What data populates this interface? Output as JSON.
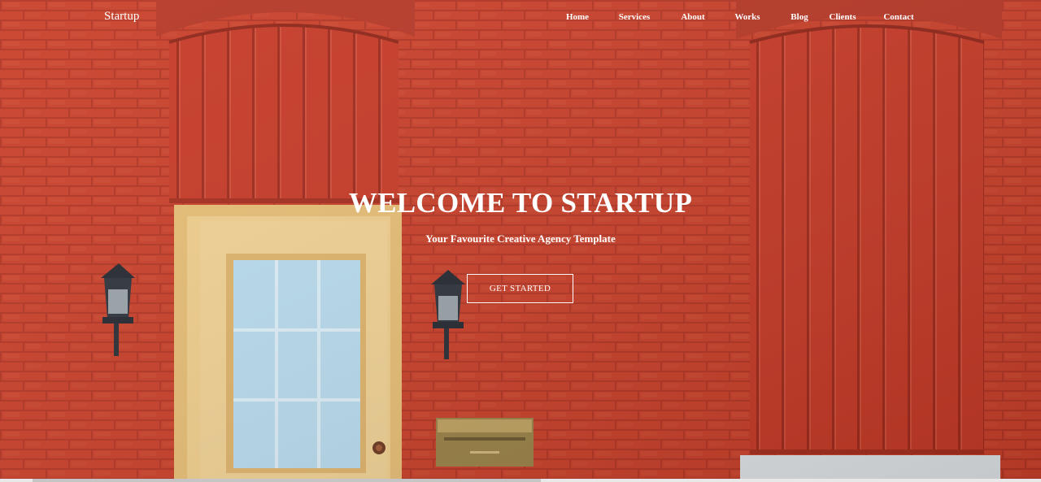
{
  "nav": {
    "brand": "Startup",
    "items": [
      {
        "label": "Home"
      },
      {
        "label": "Services"
      },
      {
        "label": "About"
      },
      {
        "label": "Works"
      },
      {
        "label": "Blog"
      },
      {
        "label": "Clients"
      },
      {
        "label": "Contact"
      }
    ]
  },
  "hero": {
    "title": "WELCOME TO STARTUP",
    "subtitle": "Your Favourite Creative Agency Template",
    "cta_label": "GET STARTED",
    "background_image": "red-brick-facade-with-door-and-lanterns"
  },
  "colors": {
    "brick": "#c8402a",
    "door_panel": "#c63a27",
    "door_frame": "#e9c27a",
    "glass": "#b9dcee",
    "text": "#ffffff"
  }
}
